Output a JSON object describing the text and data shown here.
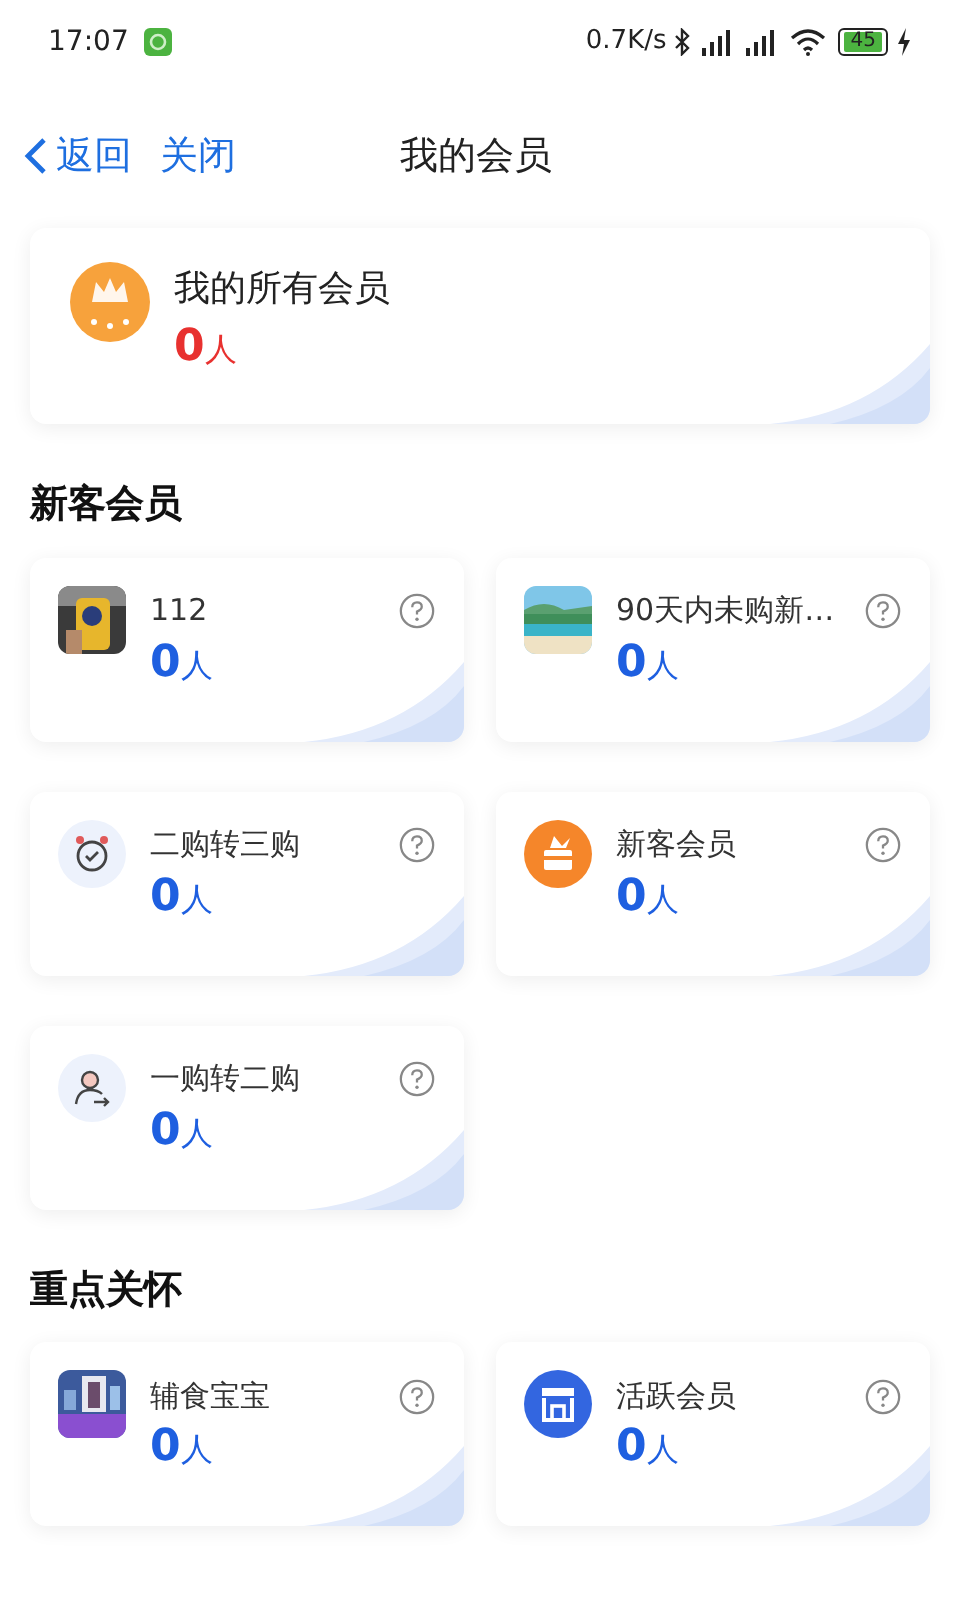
{
  "status_bar": {
    "time": "17:07",
    "speed": "0.7K/s",
    "battery": "45"
  },
  "nav": {
    "back": "返回",
    "close": "关闭",
    "title": "我的会员"
  },
  "summary": {
    "title": "我的所有会员",
    "count": "0",
    "unit": "人"
  },
  "sections": [
    {
      "title": "新客会员",
      "cards": [
        {
          "kind": "picture",
          "name": "112",
          "count": "0",
          "unit": "人"
        },
        {
          "kind": "picture",
          "name": "90天内未购新…",
          "count": "0",
          "unit": "人"
        },
        {
          "kind": "alarm",
          "name": "二购转三购",
          "count": "0",
          "unit": "人"
        },
        {
          "kind": "gift",
          "name": "新客会员",
          "count": "0",
          "unit": "人"
        },
        {
          "kind": "user",
          "name": "一购转二购",
          "count": "0",
          "unit": "人"
        }
      ]
    },
    {
      "title": "重点关怀",
      "cards": [
        {
          "kind": "picture",
          "name": "辅食宝宝",
          "count": "0",
          "unit": "人"
        },
        {
          "kind": "store",
          "name": "活跃会员",
          "count": "0",
          "unit": "人"
        }
      ]
    }
  ]
}
